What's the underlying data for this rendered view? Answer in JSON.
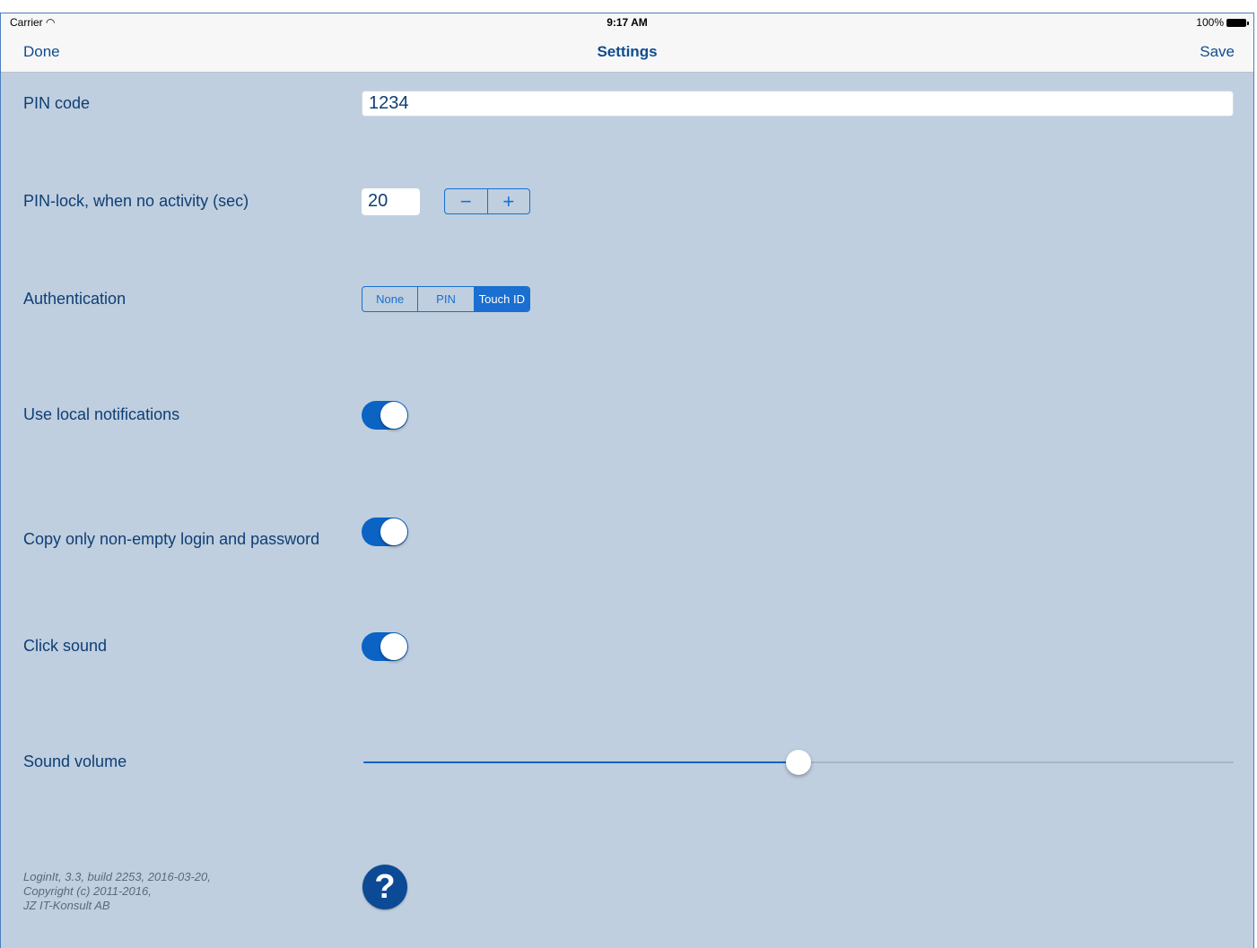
{
  "status_bar": {
    "carrier": "Carrier",
    "wifi_icon": "wifi-icon",
    "time": "9:17 AM",
    "battery": "100%"
  },
  "navbar": {
    "done_label": "Done",
    "title": "Settings",
    "save_label": "Save"
  },
  "settings": {
    "pin_code": {
      "label": "PIN code",
      "value": "1234"
    },
    "pin_lock": {
      "label": "PIN-lock, when no activity (sec)",
      "value": "20",
      "minus": "−",
      "plus": "+"
    },
    "authentication": {
      "label": "Authentication",
      "options": [
        "None",
        "PIN",
        "Touch ID"
      ],
      "selected": "Touch ID"
    },
    "local_notifications": {
      "label": "Use local notifications",
      "on": true
    },
    "copy_non_empty": {
      "label": "Copy only non-empty login and password",
      "on": true
    },
    "click_sound": {
      "label": "Click sound",
      "on": true
    },
    "sound_volume": {
      "label": "Sound volume",
      "value": 0.5
    }
  },
  "footer": {
    "line1": "LoginIt, 3.3, build 2253, 2016-03-20,",
    "line2": "Copyright (c) 2011-2016,",
    "line3": "JZ IT-Konsult AB",
    "help_glyph": "?"
  },
  "colors": {
    "background": "#bfcfdf",
    "accent": "#0b63c4",
    "label": "#0f3e75"
  }
}
